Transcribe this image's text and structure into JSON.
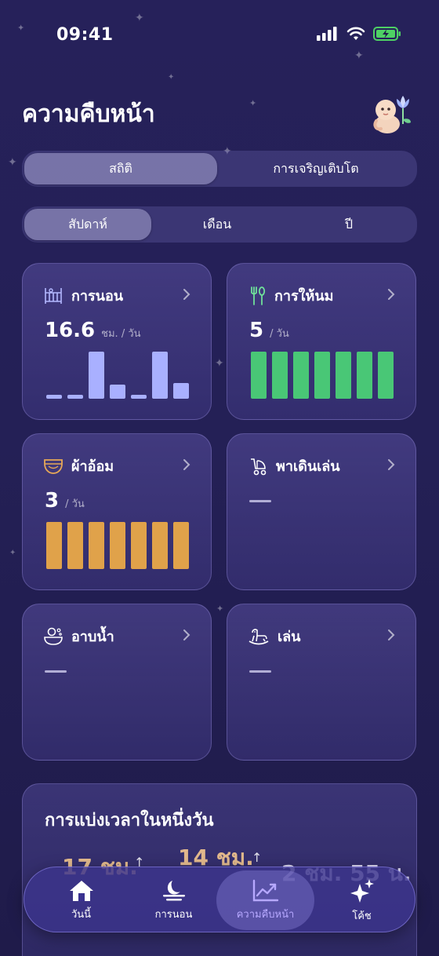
{
  "status_bar": {
    "time": "09:41"
  },
  "header": {
    "title": "ความคืบหน้า"
  },
  "main_tabs": [
    {
      "label": "สถิติ",
      "active": true
    },
    {
      "label": "การเจริญเติบโต",
      "active": false
    }
  ],
  "period_tabs": [
    {
      "label": "สัปดาห์",
      "active": true
    },
    {
      "label": "เดือน",
      "active": false
    },
    {
      "label": "ปี",
      "active": false
    }
  ],
  "cards": {
    "sleep": {
      "title": "การนอน",
      "value": "16.6",
      "unit": "ชม. / วัน",
      "icon": "crib-icon",
      "bar_color": "#a9b0ff",
      "bars": [
        0.08,
        0.08,
        1.0,
        0.3,
        0.08,
        1.0,
        0.33
      ]
    },
    "feeding": {
      "title": "การให้นม",
      "value": "5",
      "unit": "/ วัน",
      "icon": "fork-spoon-icon",
      "bar_color": "#49c776",
      "bars": [
        1,
        1,
        1,
        1,
        1,
        1,
        1
      ]
    },
    "diaper": {
      "title": "ผ้าอ้อม",
      "value": "3",
      "unit": "/ วัน",
      "icon": "diaper-icon",
      "bar_color": "#e0a24a",
      "bars": [
        1,
        1,
        1,
        1,
        1,
        1,
        1
      ]
    },
    "walk": {
      "title": "พาเดินเล่น",
      "icon": "stroller-icon"
    },
    "bath": {
      "title": "อาบน้ำ",
      "icon": "bath-icon"
    },
    "play": {
      "title": "เล่น",
      "icon": "rocking-horse-icon"
    }
  },
  "summary": {
    "title": "การแบ่งเวลาในหนึ่งวัน",
    "stat1": "17 ชม.",
    "stat2": "14 ชม.",
    "stat3": "2 ชม. 55 น."
  },
  "tabbar": [
    {
      "label": "วันนี้",
      "icon": "home-icon",
      "active": false
    },
    {
      "label": "การนอน",
      "icon": "moon-icon",
      "active": false
    },
    {
      "label": "ความคืบหน้า",
      "icon": "chart-icon",
      "active": true
    },
    {
      "label": "โค้ช",
      "icon": "sparkles-icon",
      "active": false
    }
  ],
  "colors": {
    "accent": "#b6a8ff",
    "background": "#26215a"
  }
}
